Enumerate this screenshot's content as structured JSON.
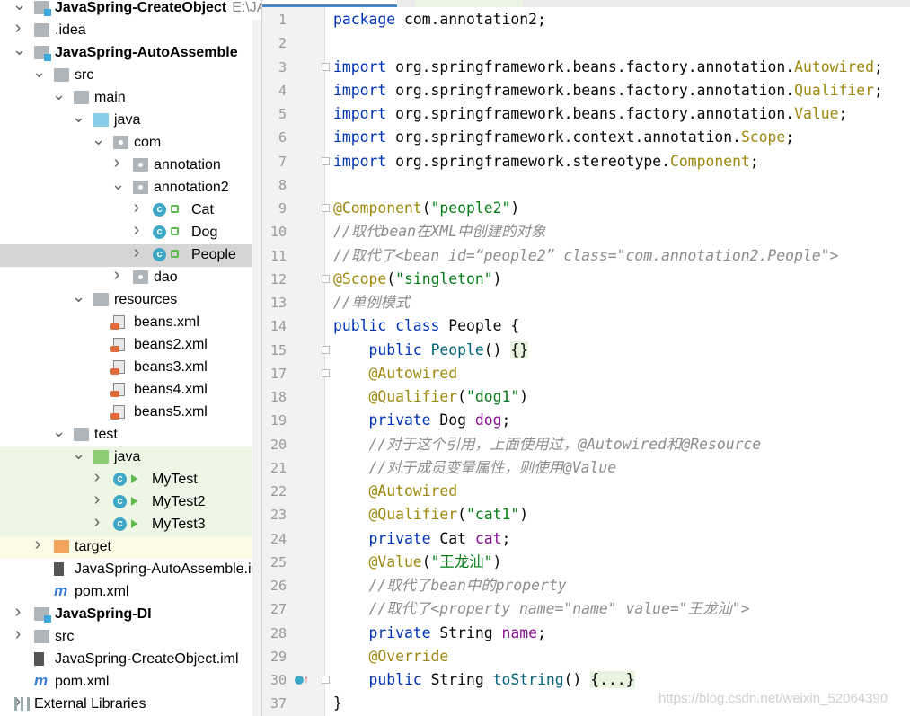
{
  "tree": [
    {
      "label": "JavaSpring-CreateObject",
      "hint": "E:\\JAVA",
      "bold": true,
      "icon": "module-folder-icon",
      "arrow": "down",
      "level": 0
    },
    {
      "label": ".idea",
      "icon": "folder-icon",
      "arrow": "right",
      "level": 0
    },
    {
      "label": "JavaSpring-AutoAssemble",
      "bold": true,
      "icon": "module-folder-icon",
      "arrow": "down",
      "level": 0
    },
    {
      "label": "src",
      "icon": "folder-icon",
      "arrow": "down",
      "level": 1
    },
    {
      "label": "main",
      "icon": "folder-icon",
      "arrow": "down",
      "level": 2
    },
    {
      "label": "java",
      "icon": "source-folder-icon",
      "arrow": "down",
      "level": 3
    },
    {
      "label": "com",
      "icon": "package-icon",
      "arrow": "down",
      "level": 4
    },
    {
      "label": "annotation",
      "icon": "package-icon",
      "arrow": "right",
      "level": 5
    },
    {
      "label": "annotation2",
      "icon": "package-icon",
      "arrow": "down",
      "level": 5
    },
    {
      "label": "Cat",
      "icon": "class-icon",
      "arrow": "right",
      "level": 6
    },
    {
      "label": "Dog",
      "icon": "class-icon",
      "arrow": "right",
      "level": 6
    },
    {
      "label": "People",
      "icon": "class-icon",
      "arrow": "right",
      "level": 6,
      "selected": true
    },
    {
      "label": "dao",
      "icon": "package-icon",
      "arrow": "right",
      "level": 5
    },
    {
      "label": "resources",
      "icon": "resources-folder-icon",
      "arrow": "down",
      "level": 3
    },
    {
      "label": "beans.xml",
      "icon": "spring-xml-icon",
      "level": 4
    },
    {
      "label": "beans2.xml",
      "icon": "spring-xml-icon",
      "level": 4
    },
    {
      "label": "beans3.xml",
      "icon": "spring-xml-icon",
      "level": 4
    },
    {
      "label": "beans4.xml",
      "icon": "spring-xml-icon",
      "level": 4
    },
    {
      "label": "beans5.xml",
      "icon": "spring-xml-icon",
      "level": 4
    },
    {
      "label": "test",
      "icon": "folder-icon",
      "arrow": "down",
      "level": 2
    },
    {
      "label": "java",
      "icon": "test-folder-icon",
      "arrow": "down",
      "level": 3,
      "test": true
    },
    {
      "label": "MyTest",
      "icon": "test-class-icon",
      "arrow": "right",
      "level": 4,
      "test": true
    },
    {
      "label": "MyTest2",
      "icon": "test-class-icon",
      "arrow": "right",
      "level": 4,
      "test": true
    },
    {
      "label": "MyTest3",
      "icon": "test-class-icon",
      "arrow": "right",
      "level": 4,
      "test": true
    },
    {
      "label": "target",
      "icon": "excluded-folder-icon",
      "arrow": "right",
      "level": 1,
      "excluded": true
    },
    {
      "label": "JavaSpring-AutoAssemble.iml",
      "icon": "iml-file-icon",
      "level": 1
    },
    {
      "label": "pom.xml",
      "icon": "maven-icon",
      "level": 1
    },
    {
      "label": "JavaSpring-DI",
      "bold": true,
      "icon": "module-folder-icon",
      "arrow": "right",
      "level": 0
    },
    {
      "label": "src",
      "icon": "folder-icon",
      "arrow": "right",
      "level": 0
    },
    {
      "label": "JavaSpring-CreateObject.iml",
      "icon": "iml-file-icon",
      "level": 0
    },
    {
      "label": "pom.xml",
      "icon": "maven-icon",
      "level": 0
    },
    {
      "label": "External Libraries",
      "icon": "libraries-icon",
      "arrow": "right",
      "level": -1
    }
  ],
  "editor": {
    "lines": [
      {
        "n": "1",
        "t": [
          [
            "package ",
            "kw"
          ],
          [
            "com.annotation2;",
            ""
          ]
        ]
      },
      {
        "n": "2",
        "t": []
      },
      {
        "n": "3",
        "fold": true,
        "t": [
          [
            "import ",
            "kw"
          ],
          [
            "org.springframework.beans.factory.annotation.",
            ""
          ],
          [
            "Autowired",
            "an"
          ],
          [
            ";",
            ""
          ]
        ]
      },
      {
        "n": "4",
        "t": [
          [
            "import ",
            "kw"
          ],
          [
            "org.springframework.beans.factory.annotation.",
            ""
          ],
          [
            "Qualifier",
            "an"
          ],
          [
            ";",
            ""
          ]
        ]
      },
      {
        "n": "5",
        "t": [
          [
            "import ",
            "kw"
          ],
          [
            "org.springframework.beans.factory.annotation.",
            ""
          ],
          [
            "Value",
            "an"
          ],
          [
            ";",
            ""
          ]
        ]
      },
      {
        "n": "6",
        "t": [
          [
            "import ",
            "kw"
          ],
          [
            "org.springframework.context.annotation.",
            ""
          ],
          [
            "Scope",
            "an"
          ],
          [
            ";",
            ""
          ]
        ]
      },
      {
        "n": "7",
        "fold": true,
        "t": [
          [
            "import ",
            "kw"
          ],
          [
            "org.springframework.stereotype.",
            ""
          ],
          [
            "Component",
            "an"
          ],
          [
            ";",
            ""
          ]
        ]
      },
      {
        "n": "8",
        "t": []
      },
      {
        "n": "9",
        "fold": true,
        "t": [
          [
            "@Component",
            "an"
          ],
          [
            "(",
            ""
          ],
          [
            "\"people2\"",
            "st"
          ],
          [
            ")",
            ""
          ]
        ]
      },
      {
        "n": "10",
        "t": [
          [
            "//取代bean在XML中创建的对象",
            "cm"
          ]
        ]
      },
      {
        "n": "11",
        "t": [
          [
            "//取代了<bean id=“people2” class=\"com.annotation2.People\">",
            "cm"
          ]
        ]
      },
      {
        "n": "12",
        "fold": true,
        "t": [
          [
            "@Scope",
            "an"
          ],
          [
            "(",
            ""
          ],
          [
            "\"singleton\"",
            "st"
          ],
          [
            ")",
            ""
          ]
        ]
      },
      {
        "n": "13",
        "t": [
          [
            "//单例模式",
            "cm"
          ]
        ]
      },
      {
        "n": "14",
        "t": [
          [
            "public class ",
            "kw"
          ],
          [
            "People {",
            ""
          ]
        ]
      },
      {
        "n": "15",
        "fold": true,
        "t": [
          [
            "    public ",
            "kw"
          ],
          [
            "People",
            "fn"
          ],
          [
            "() ",
            ""
          ],
          [
            "{}",
            "br"
          ]
        ]
      },
      {
        "n": "17",
        "fold": true,
        "t": [
          [
            "    @Autowired",
            "an"
          ]
        ]
      },
      {
        "n": "18",
        "t": [
          [
            "    @Qualifier",
            "an"
          ],
          [
            "(",
            ""
          ],
          [
            "\"dog1\"",
            "st"
          ],
          [
            ")",
            ""
          ]
        ]
      },
      {
        "n": "19",
        "t": [
          [
            "    private ",
            "kw"
          ],
          [
            "Dog ",
            ""
          ],
          [
            "dog",
            "fd"
          ],
          [
            ";",
            ""
          ]
        ]
      },
      {
        "n": "20",
        "t": [
          [
            "    //对于这个引用，上面使用过，@Autowired和@Resource",
            "cm"
          ]
        ]
      },
      {
        "n": "21",
        "t": [
          [
            "    //对于成员变量属性，则使用@Value",
            "cm"
          ]
        ]
      },
      {
        "n": "22",
        "t": [
          [
            "    @Autowired",
            "an"
          ]
        ]
      },
      {
        "n": "23",
        "t": [
          [
            "    @Qualifier",
            "an"
          ],
          [
            "(",
            ""
          ],
          [
            "\"cat1\"",
            "st"
          ],
          [
            ")",
            ""
          ]
        ]
      },
      {
        "n": "24",
        "t": [
          [
            "    private ",
            "kw"
          ],
          [
            "Cat ",
            ""
          ],
          [
            "cat",
            "fd"
          ],
          [
            ";",
            ""
          ]
        ]
      },
      {
        "n": "25",
        "t": [
          [
            "    @Value",
            "an"
          ],
          [
            "(",
            ""
          ],
          [
            "\"王龙汕\"",
            "st"
          ],
          [
            ")",
            ""
          ]
        ]
      },
      {
        "n": "26",
        "t": [
          [
            "    //取代了bean中的property",
            "cm"
          ]
        ]
      },
      {
        "n": "27",
        "t": [
          [
            "    //取代了<property name=\"name\" value=\"王龙汕\">",
            "cm"
          ]
        ]
      },
      {
        "n": "28",
        "t": [
          [
            "    private ",
            "kw"
          ],
          [
            "String ",
            ""
          ],
          [
            "name",
            "fd"
          ],
          [
            ";",
            ""
          ]
        ]
      },
      {
        "n": "29",
        "t": [
          [
            "    @Override",
            "an"
          ]
        ]
      },
      {
        "n": "30",
        "fold": true,
        "override": true,
        "t": [
          [
            "    public ",
            "kw"
          ],
          [
            "String ",
            ""
          ],
          [
            "toString",
            "fn"
          ],
          [
            "() ",
            ""
          ],
          [
            "{...}",
            "br"
          ]
        ]
      },
      {
        "n": "37",
        "t": [
          [
            "}",
            ""
          ]
        ]
      }
    ]
  },
  "watermark": "https://blog.csdn.net/weixin_52064390"
}
